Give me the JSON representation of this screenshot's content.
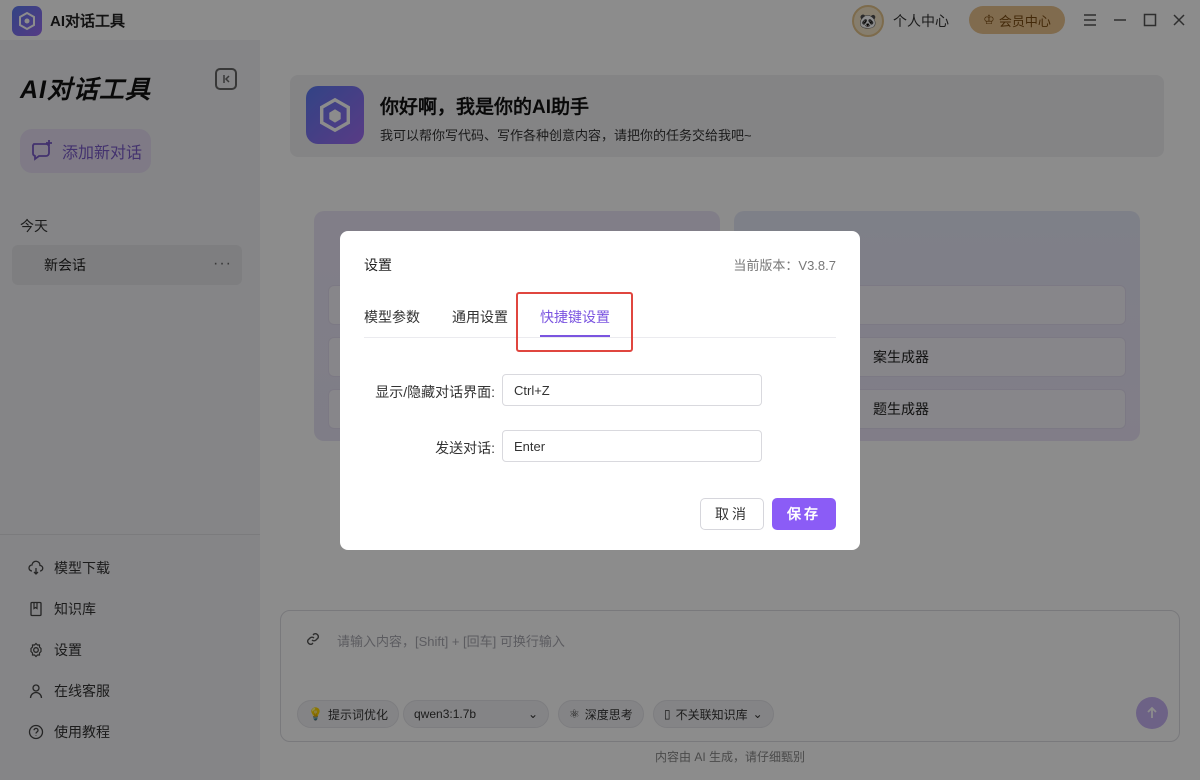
{
  "app": {
    "title": "AI对话工具",
    "profile_label": "个人中心",
    "vip_label": "会员中心"
  },
  "sidebar": {
    "title": "AI对话工具",
    "new_chat_label": "添加新对话",
    "section_today": "今天",
    "conversations": [
      {
        "title": "新会话",
        "more": "···"
      }
    ],
    "menu": [
      {
        "label": "模型下载",
        "icon": "cloud-download-icon"
      },
      {
        "label": "知识库",
        "icon": "book-icon"
      },
      {
        "label": "设置",
        "icon": "gear-icon"
      },
      {
        "label": "在线客服",
        "icon": "user-icon"
      },
      {
        "label": "使用教程",
        "icon": "help-icon"
      }
    ]
  },
  "main": {
    "welcome_title": "你好啊，我是你的AI助手",
    "welcome_subtitle": "我可以帮你写代码、写作各种创意内容，请把你的任务交给我吧~",
    "cards": {
      "right_rows": [
        "案生成器",
        "题生成器"
      ]
    },
    "input_placeholder": "请输入内容，[Shift] + [回车] 可换行输入",
    "toolbar": {
      "prompt_optimize": "提示词优化",
      "model_value": "qwen3:1.7b",
      "deep_think": "深度思考",
      "knowledge": "不关联知识库"
    },
    "disclaimer": "内容由 AI 生成，请仔细甄别"
  },
  "modal": {
    "title": "设置",
    "version": "当前版本：V3.8.7",
    "tabs": [
      {
        "label": "模型参数"
      },
      {
        "label": "通用设置"
      },
      {
        "label": "快捷键设置"
      }
    ],
    "active_tab": "快捷键设置",
    "fields": [
      {
        "label": "显示/隐藏对话界面:",
        "value": "Ctrl+Z"
      },
      {
        "label": "发送对话:",
        "value": "Enter"
      }
    ],
    "cancel_label": "取消",
    "save_label": "保存"
  },
  "colors": {
    "accent": "#8b5cf6",
    "highlight": "#e0463f",
    "vip": "#e9c38e"
  }
}
